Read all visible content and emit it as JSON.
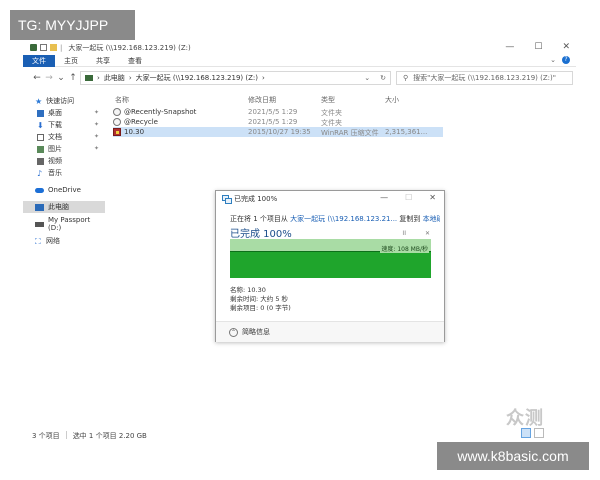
{
  "watermarks": {
    "top_left": "TG: MYYJJPP",
    "bottom_right": "www.k8basic.com",
    "logo": "众测"
  },
  "titlebar": {
    "path": "大家一起玩 (\\\\192.168.123.219) (Z:)",
    "minimize": "—",
    "maximize": "☐",
    "close": "✕"
  },
  "ribbon": {
    "tabs": [
      {
        "label": "文件",
        "active": true
      },
      {
        "label": "主页"
      },
      {
        "label": "共享"
      },
      {
        "label": "查看"
      }
    ],
    "expand": "⌄",
    "help": "?"
  },
  "address": {
    "back": "←",
    "forward": "→",
    "recent": "⌄",
    "up": "↑",
    "crumbs": [
      "此电脑",
      "大家一起玩 (\\\\192.168.123.219) (Z:)"
    ],
    "sep": "›",
    "dropdown": "⌄",
    "refresh": "↻",
    "search_placeholder": "搜索\"大家一起玩 (\\\\192.168.123.219) (Z:)\""
  },
  "nav": {
    "quick_access": "快速访问",
    "items": [
      {
        "label": "桌面",
        "pinned": true
      },
      {
        "label": "下载",
        "pinned": true
      },
      {
        "label": "文档",
        "pinned": true
      },
      {
        "label": "图片",
        "pinned": true
      },
      {
        "label": "视频"
      },
      {
        "label": "音乐"
      }
    ],
    "onedrive": "OneDrive",
    "this_pc": "此电脑",
    "passport": "My Passport (D:)",
    "network": "网络",
    "pin_glyph": "✦"
  },
  "columns": {
    "name": "名称",
    "date": "修改日期",
    "type": "类型",
    "size": "大小"
  },
  "files": [
    {
      "name": "@Recently-Snapshot",
      "date": "2021/5/5 1:29",
      "type": "文件夹",
      "size": ""
    },
    {
      "name": "@Recycle",
      "date": "2021/5/5 1:29",
      "type": "文件夹",
      "size": ""
    },
    {
      "name": "10.30",
      "date": "2015/10/27 19:35",
      "type": "WinRAR 压缩文件",
      "size": "2,315,361..."
    }
  ],
  "status": {
    "count": "3 个项目",
    "selected": "选中 1 个项目  2.20 GB"
  },
  "dialog": {
    "title": "已完成 100%",
    "line_prefix": "正在将 1 个项目从",
    "source": "大家一起玩 (\\\\192.168.123.21...",
    "line_mid": "复制到",
    "dest": "本地磁盘 (C:)",
    "heading": "已完成 100%",
    "pause": "II",
    "cancel": "✕",
    "speed": "速度: 108 MB/秒",
    "progress_fraction": 1.0,
    "name_label": "名称: 10.30",
    "time_left": "剩余时间: 大约 5 秒",
    "items_left": "剩余项目: 0 (0 字节)",
    "less_details": "简略信息",
    "chevron": "⌃"
  }
}
